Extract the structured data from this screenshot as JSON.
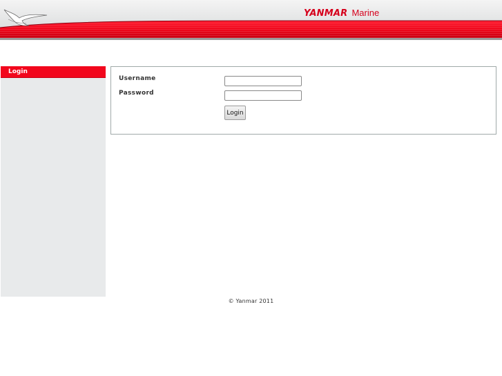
{
  "header": {
    "brand_main": "YANMAR",
    "brand_sub": "Marine",
    "logo_icon": "seagull-logo-icon"
  },
  "sidebar": {
    "items": [
      {
        "label": "Login"
      }
    ]
  },
  "login_form": {
    "username_label": "Username",
    "username_value": "",
    "password_label": "Password",
    "password_value": "",
    "submit_label": "Login"
  },
  "footer": {
    "copyright": "© Yanmar 2011"
  },
  "colors": {
    "accent_red": "#f2071d",
    "sidebar_bg": "#e8eaeb",
    "box_border": "#9fa9a8"
  }
}
